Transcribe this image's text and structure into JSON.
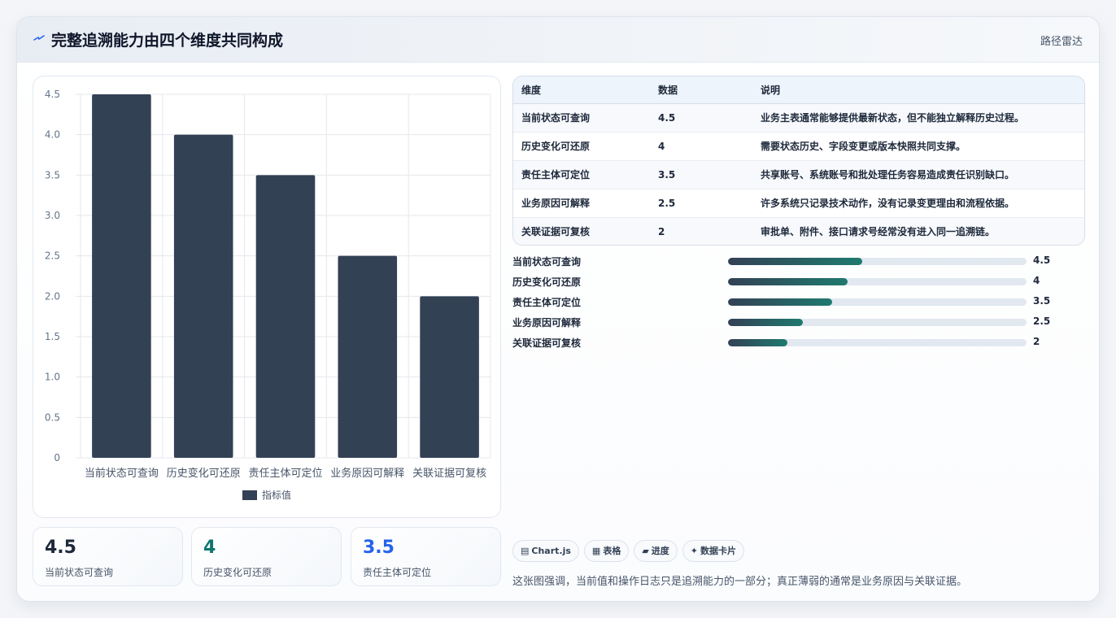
{
  "header": {
    "title": "完整追溯能力由四个维度共同构成",
    "tag": "路径雷达",
    "logo_icon": "lightning-icon"
  },
  "chart_data": {
    "type": "bar",
    "categories": [
      "当前状态可查询",
      "历史变化可还原",
      "责任主体可定位",
      "业务原因可解释",
      "关联证据可复核"
    ],
    "series": [
      {
        "name": "指标值",
        "values": [
          4.5,
          4,
          3.5,
          2.5,
          2
        ],
        "color": "#334155"
      }
    ],
    "yticks": [
      "0",
      "0.5",
      "1.0",
      "1.5",
      "2.0",
      "2.5",
      "3.0",
      "3.5",
      "4.0",
      "4.5"
    ],
    "ylim": [
      0,
      4.5
    ],
    "grid": true,
    "legend": "bottom"
  },
  "kpis": [
    {
      "value": "4.5",
      "label": "当前状态可查询",
      "color": "#1e293b"
    },
    {
      "value": "4",
      "label": "历史变化可还原",
      "color": "#0f766e"
    },
    {
      "value": "3.5",
      "label": "责任主体可定位",
      "color": "#2563eb"
    }
  ],
  "table": {
    "headers": [
      "维度",
      "数据",
      "说明"
    ],
    "rows": [
      [
        "当前状态可查询",
        "4.5",
        "业务主表通常能够提供最新状态，但不能独立解释历史过程。"
      ],
      [
        "历史变化可还原",
        "4",
        "需要状态历史、字段变更或版本快照共同支撑。"
      ],
      [
        "责任主体可定位",
        "3.5",
        "共享账号、系统账号和批处理任务容易造成责任识别缺口。"
      ],
      [
        "业务原因可解释",
        "2.5",
        "许多系统只记录技术动作，没有记录变更理由和流程依据。"
      ],
      [
        "关联证据可复核",
        "2",
        "审批单、附件、接口请求号经常没有进入同一追溯链。"
      ]
    ]
  },
  "progress": {
    "max": 10,
    "items": [
      {
        "label": "当前状态可查询",
        "value": "4.5"
      },
      {
        "label": "历史变化可还原",
        "value": "4"
      },
      {
        "label": "责任主体可定位",
        "value": "3.5"
      },
      {
        "label": "业务原因可解释",
        "value": "2.5"
      },
      {
        "label": "关联证据可复核",
        "value": "2"
      }
    ]
  },
  "chips": [
    {
      "icon": "▤",
      "icon_name": "chart-icon",
      "label": "Chart.js"
    },
    {
      "icon": "▦",
      "icon_name": "table-icon",
      "label": "表格"
    },
    {
      "icon": "▰",
      "icon_name": "progress-icon",
      "label": "进度"
    },
    {
      "icon": "✦",
      "icon_name": "sparkle-icon",
      "label": "数据卡片"
    }
  ],
  "footnote": "这张图强调，当前值和操作日志只是追溯能力的一部分；真正薄弱的通常是业务原因与关联证据。"
}
